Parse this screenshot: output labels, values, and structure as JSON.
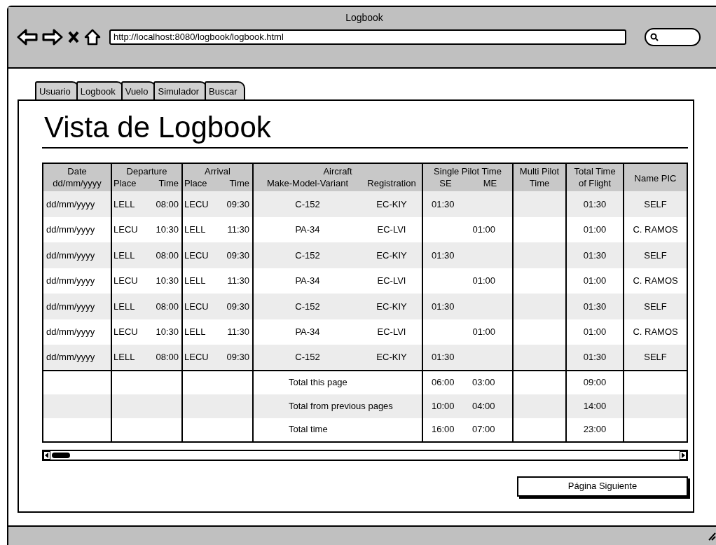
{
  "browser": {
    "title": "Logbook",
    "url": "http://localhost:8080/logbook/logbook.html"
  },
  "tabs": [
    "Usuario",
    "Logbook",
    "Vuelo",
    "Simulador",
    "Buscar"
  ],
  "heading": "Vista de Logbook",
  "table": {
    "header_groups": [
      {
        "label": "Date",
        "sub": [
          "dd/mm/yyyy"
        ]
      },
      {
        "label": "Departure",
        "sub": [
          "Place",
          "Time"
        ]
      },
      {
        "label": "Arrival",
        "sub": [
          "Place",
          "Time"
        ]
      },
      {
        "label": "Aircraft",
        "sub": [
          "Make-Model-Variant",
          "Registration"
        ]
      },
      {
        "label": "Single Pilot Time",
        "sub": [
          "SE",
          "ME"
        ]
      },
      {
        "label": "Multi Pilot",
        "sub": [
          "Time"
        ]
      },
      {
        "label": "Total Time",
        "sub": [
          "of Flight"
        ]
      },
      {
        "label": "Name PIC"
      }
    ],
    "rows": [
      [
        "dd/mm/yyyy",
        "LELL",
        "08:00",
        "LECU",
        "09:30",
        "C-152",
        "EC-KIY",
        "01:30",
        "",
        "",
        "01:30",
        "SELF"
      ],
      [
        "dd/mm/yyyy",
        "LECU",
        "10:30",
        "LELL",
        "11:30",
        "PA-34",
        "EC-LVI",
        "",
        "01:00",
        "",
        "01:00",
        "C. RAMOS"
      ],
      [
        "dd/mm/yyyy",
        "LELL",
        "08:00",
        "LECU",
        "09:30",
        "C-152",
        "EC-KIY",
        "01:30",
        "",
        "",
        "01:30",
        "SELF"
      ],
      [
        "dd/mm/yyyy",
        "LECU",
        "10:30",
        "LELL",
        "11:30",
        "PA-34",
        "EC-LVI",
        "",
        "01:00",
        "",
        "01:00",
        "C. RAMOS"
      ],
      [
        "dd/mm/yyyy",
        "LELL",
        "08:00",
        "LECU",
        "09:30",
        "C-152",
        "EC-KIY",
        "01:30",
        "",
        "",
        "01:30",
        "SELF"
      ],
      [
        "dd/mm/yyyy",
        "LECU",
        "10:30",
        "LELL",
        "11:30",
        "PA-34",
        "EC-LVI",
        "",
        "01:00",
        "",
        "01:00",
        "C. RAMOS"
      ],
      [
        "dd/mm/yyyy",
        "LELL",
        "08:00",
        "LECU",
        "09:30",
        "C-152",
        "EC-KIY",
        "01:30",
        "",
        "",
        "01:30",
        "SELF"
      ]
    ],
    "totals": [
      {
        "label": "Total this page",
        "se": "06:00",
        "me": "03:00",
        "total": "09:00"
      },
      {
        "label": "Total from previous pages",
        "se": "10:00",
        "me": "04:00",
        "total": "14:00"
      },
      {
        "label": "Total time",
        "se": "16:00",
        "me": "07:00",
        "total": "23:00"
      }
    ]
  },
  "next_button": "Página Siguiente"
}
